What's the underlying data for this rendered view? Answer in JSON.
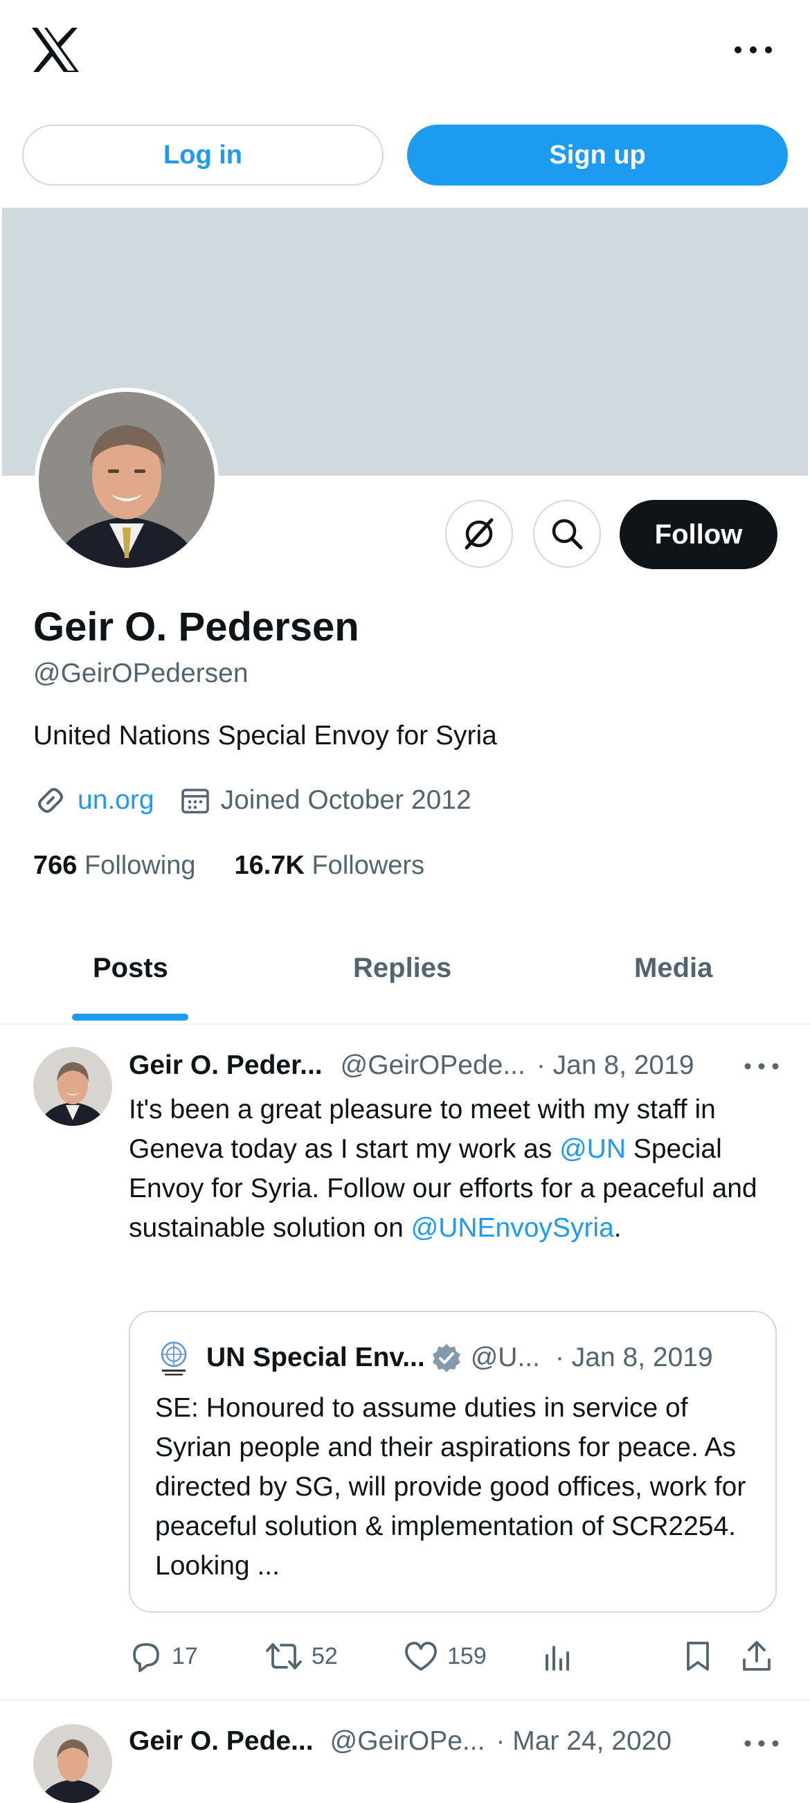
{
  "header": {
    "logo_icon": "x-logo-icon",
    "more_icon": "more-horizontal-icon",
    "login_label": "Log in",
    "signup_label": "Sign up"
  },
  "profile": {
    "name": "Geir O. Pedersen",
    "handle": "@GeirOPedersen",
    "bio": "United Nations Special Envoy for Syria",
    "link": "un.org",
    "joined": "Joined October 2012",
    "following_count": "766",
    "following_label": "Following",
    "followers_count": "16.7K",
    "followers_label": "Followers",
    "follow_label": "Follow",
    "banner_color": "#cfd9de"
  },
  "tabs": [
    {
      "label": "Posts",
      "active": true
    },
    {
      "label": "Replies",
      "active": false
    },
    {
      "label": "Media",
      "active": false
    }
  ],
  "tweets": [
    {
      "author": "Geir O. Peder...",
      "handle": "@GeirOPede...",
      "date": "· Jan 8, 2019",
      "text_parts": {
        "a": "It's been a great pleasure to meet with my staff in Geneva today as I start my work as ",
        "m1": "@UN",
        "b": " Special Envoy for Syria. Follow our efforts for a peaceful and sustainable solution on ",
        "m2": "@UNEnvoySyria",
        "c": "."
      },
      "quote": {
        "author": "UN Special Env...",
        "handle": "@U...",
        "date": "· Jan 8, 2019",
        "text": "SE:  Honoured to assume duties in service of Syrian people and their aspirations for peace.  As directed by SG, will provide good offices, work for peaceful solution & implementation of SCR2254.  Looking ..."
      },
      "replies": "17",
      "reposts": "52",
      "likes": "159"
    },
    {
      "author": "Geir O. Pede...",
      "handle": "@GeirOPe...",
      "date": "· Mar 24, 2020"
    }
  ],
  "colors": {
    "accent": "#1d9bf0",
    "text": "#0f1419",
    "muted": "#536471",
    "border": "#cfd9de"
  }
}
